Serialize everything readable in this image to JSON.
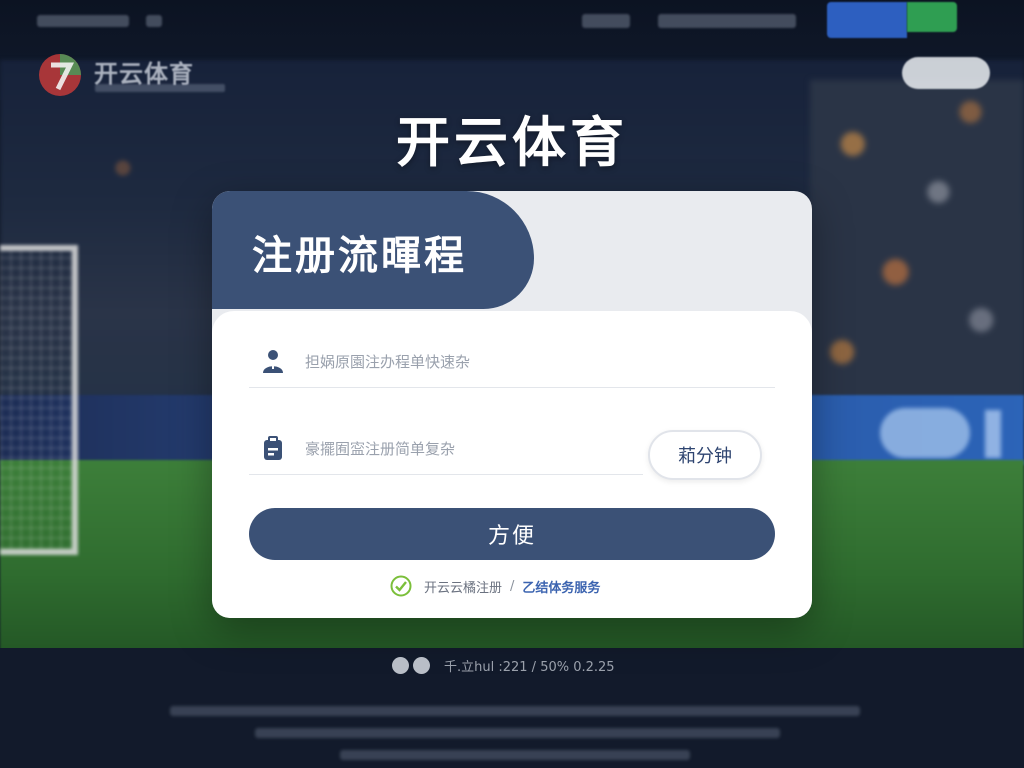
{
  "brand": {
    "title": "开云体育",
    "logo_text": "开云体育",
    "accent": "#3b5176",
    "logo_icon": "brand-seven-badge-icon"
  },
  "top_nav": {
    "login_label": "",
    "register_label": ""
  },
  "card": {
    "heading": "注册流暉程",
    "username": {
      "placeholder": "担娲原園注办程单快速杂",
      "value": "",
      "icon": "user-icon"
    },
    "code": {
      "placeholder": "豪擺囿寍注册简单复杂",
      "value": "",
      "icon": "verification-doc-icon"
    },
    "code_button_label": "萂分钟",
    "submit_label": "方便",
    "agreement": {
      "check_icon": "check-circle-icon",
      "text": "开云云橘注册",
      "separator": "/",
      "link_label": "乙结体务服务"
    }
  },
  "status": {
    "text": "千.立hul :221 / 50% 0.2.25"
  },
  "colors": {
    "card_tab": "#3b5176",
    "submit_button": "#3b5176",
    "link": "#3c64b0",
    "check_green": "#7bbf3a"
  }
}
